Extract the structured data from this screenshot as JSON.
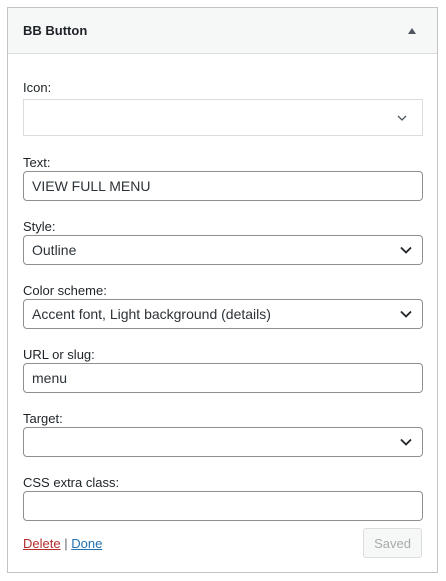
{
  "widget": {
    "title": "BB Button"
  },
  "fields": {
    "icon": {
      "label": "Icon:",
      "value": ""
    },
    "text": {
      "label": "Text:",
      "value": "VIEW FULL MENU"
    },
    "style": {
      "label": "Style:",
      "value": "Outline"
    },
    "color_scheme": {
      "label": "Color scheme:",
      "value": "Accent font, Light background (details)"
    },
    "url": {
      "label": "URL or slug:",
      "value": "menu"
    },
    "target": {
      "label": "Target:",
      "value": ""
    },
    "css_class": {
      "label": "CSS extra class:",
      "value": ""
    }
  },
  "footer": {
    "delete_label": "Delete",
    "separator": "|",
    "done_label": "Done",
    "saved_label": "Saved"
  },
  "colors": {
    "delete_link": "#b32d2e",
    "done_link": "#2271b1",
    "border": "#8c8f94"
  }
}
